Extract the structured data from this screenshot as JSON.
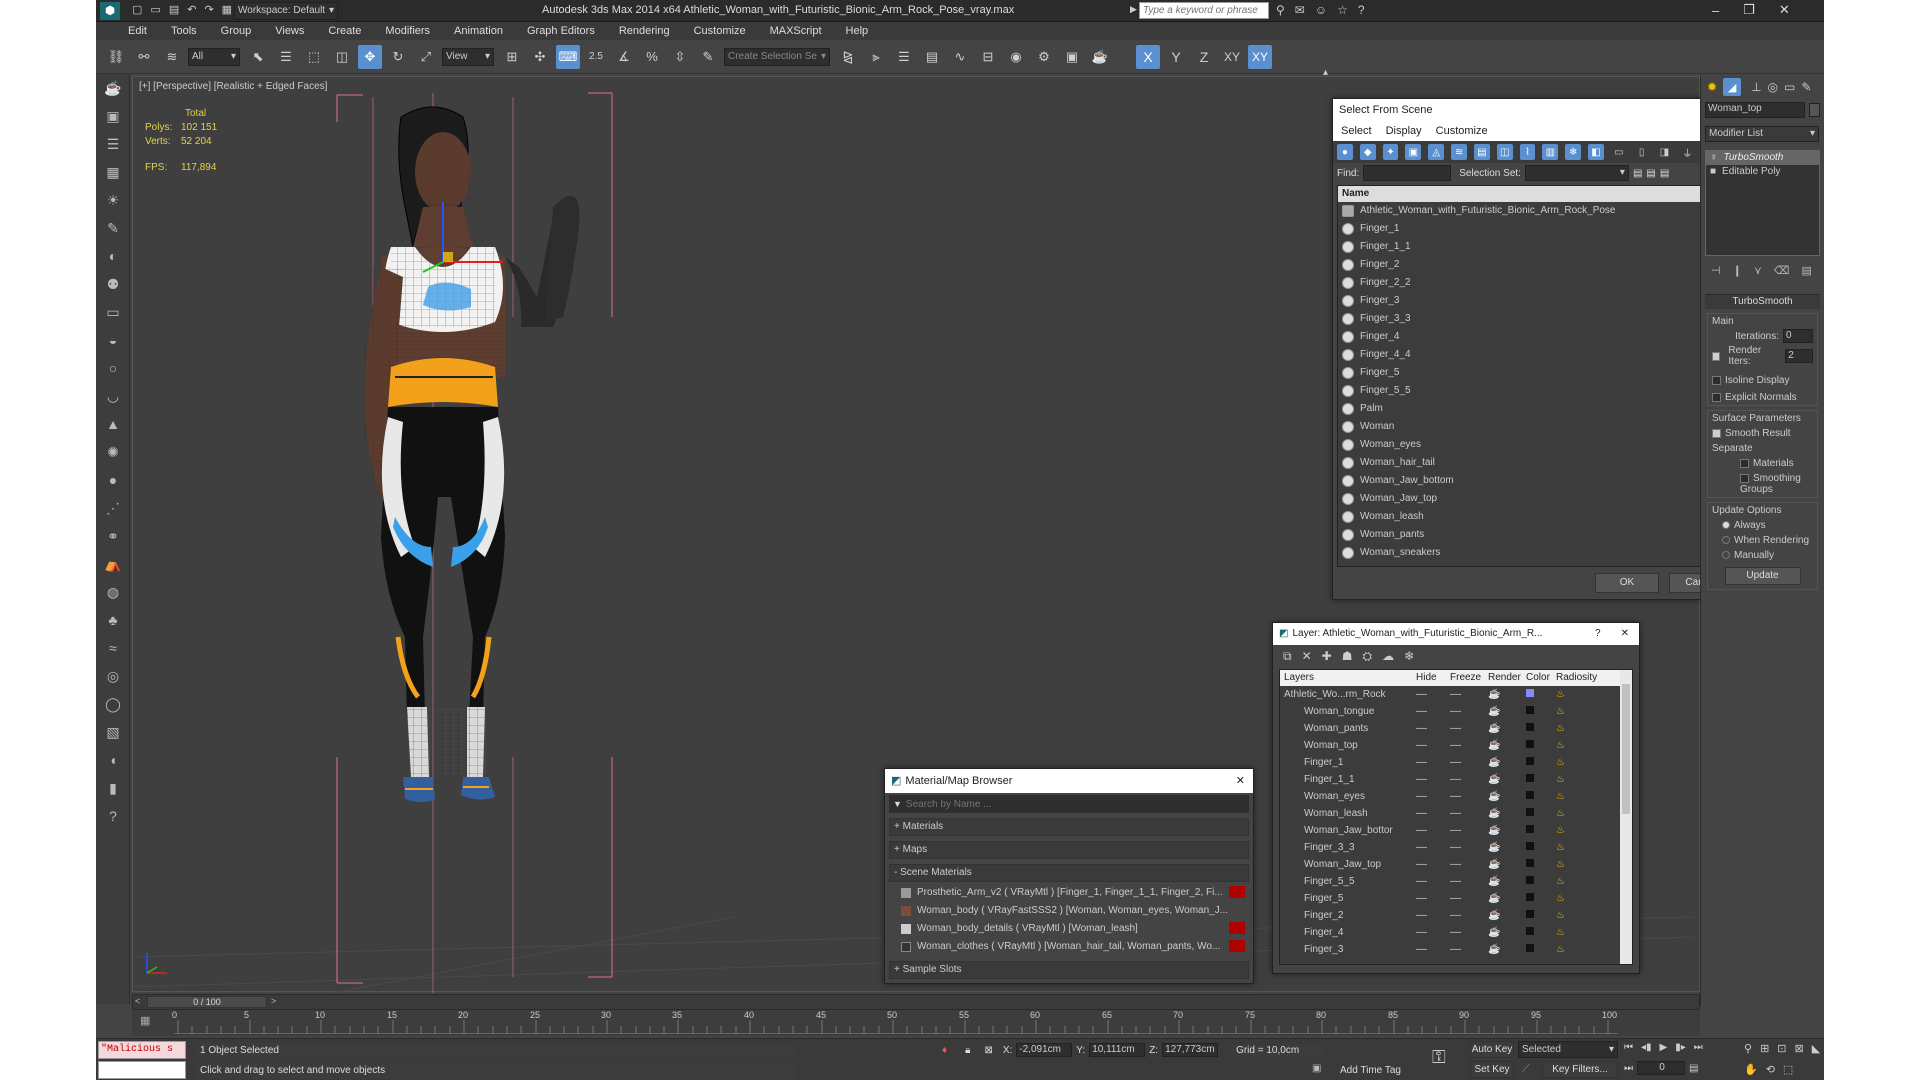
{
  "title_bar": {
    "workspace": "Workspace: Default",
    "title": "Autodesk 3ds Max  2014 x64    Athletic_Woman_with_Futuristic_Bionic_Arm_Rock_Pose_vray.max",
    "search_placeholder": "Type a keyword or phrase"
  },
  "menu": [
    "Edit",
    "Tools",
    "Group",
    "Views",
    "Create",
    "Modifiers",
    "Animation",
    "Graph Editors",
    "Rendering",
    "Customize",
    "MAXScript",
    "Help"
  ],
  "toolbar": {
    "filter": "All",
    "refcoord": "View",
    "selset_placeholder": "Create Selection Se",
    "angle_snap": "2.5",
    "axes": [
      "X",
      "Y",
      "Z",
      "XY",
      "XY"
    ]
  },
  "viewport": {
    "label": "[+] [Perspective] [Realistic + Edged Faces]",
    "stats": {
      "total_label": "Total",
      "polys_label": "Polys:",
      "polys": "102 151",
      "verts_label": "Verts:",
      "verts": "52 204",
      "fps_label": "FPS:",
      "fps": "117,894"
    }
  },
  "select_from_scene": {
    "title": "Select From Scene",
    "menu": [
      "Select",
      "Display",
      "Customize"
    ],
    "find_label": "Find:",
    "selection_set_label": "Selection Set:",
    "column_name": "Name",
    "items": [
      "Athletic_Woman_with_Futuristic_Bionic_Arm_Rock_Pose",
      "Finger_1",
      "Finger_1_1",
      "Finger_2",
      "Finger_2_2",
      "Finger_3",
      "Finger_3_3",
      "Finger_4",
      "Finger_4_4",
      "Finger_5",
      "Finger_5_5",
      "Palm",
      "Woman",
      "Woman_eyes",
      "Woman_hair_tail",
      "Woman_Jaw_bottom",
      "Woman_Jaw_top",
      "Woman_leash",
      "Woman_pants",
      "Woman_sneakers"
    ],
    "ok": "OK",
    "cancel": "Cancel"
  },
  "layer_dialog": {
    "title": "Layer: Athletic_Woman_with_Futuristic_Bionic_Arm_R...",
    "help": "?",
    "columns": [
      "Layers",
      "Hide",
      "Freeze",
      "Render",
      "Color",
      "Radiosity"
    ],
    "root": "Athletic_Wo...rm_Rock",
    "items": [
      "Woman_tongue",
      "Woman_pants",
      "Woman_top",
      "Finger_1",
      "Finger_1_1",
      "Woman_eyes",
      "Woman_leash",
      "Woman_Jaw_bottor",
      "Finger_3_3",
      "Woman_Jaw_top",
      "Finger_5_5",
      "Finger_5",
      "Finger_2",
      "Finger_4",
      "Finger_3"
    ]
  },
  "material_browser": {
    "title": "Material/Map Browser",
    "search_placeholder": "Search by Name ...",
    "sections": [
      "+ Materials",
      "+ Maps",
      "- Scene Materials"
    ],
    "materials": [
      "Prosthetic_Arm_v2  ( VRayMtl )  [Finger_1, Finger_1_1, Finger_2, Fi...",
      "Woman_body  ( VRayFastSSS2 )  [Woman, Woman_eyes, Woman_J...",
      "Woman_body_details  ( VRayMtl )  [Woman_leash]",
      "Woman_clothes  ( VRayMtl )  [Woman_hair_tail, Woman_pants, Wo..."
    ],
    "sample_slots": "+ Sample Slots"
  },
  "command_panel": {
    "object_name": "Woman_top",
    "modifier_list": "Modifier List",
    "stack": [
      "TurboSmooth",
      "Editable Poly"
    ],
    "rollout": "TurboSmooth",
    "main": "Main",
    "iterations_label": "Iterations:",
    "iterations": "0",
    "render_iters_label": "Render Iters:",
    "render_iters": "2",
    "isoline": "Isoline Display",
    "explicit_normals": "Explicit Normals",
    "surface_params": "Surface Parameters",
    "smooth_result": "Smooth Result",
    "separate": "Separate",
    "materials": "Materials",
    "smoothing_groups": "Smoothing Groups",
    "update_options": "Update Options",
    "always": "Always",
    "when_rendering": "When Rendering",
    "manually": "Manually",
    "update": "Update"
  },
  "timeline": {
    "frame": "0 / 100",
    "ticks": [
      "0",
      "5",
      "10",
      "15",
      "20",
      "25",
      "30",
      "35",
      "40",
      "45",
      "50",
      "55",
      "60",
      "65",
      "70",
      "75",
      "80",
      "85",
      "90",
      "95",
      "100"
    ]
  },
  "status": {
    "maxscript": "\"Malicious s",
    "selected": "1 Object Selected",
    "prompt": "Click and drag to select and move objects",
    "x_label": "X:",
    "x": "-2,091cm",
    "y_label": "Y:",
    "y": "10,111cm",
    "z_label": "Z:",
    "z": "127,773cm",
    "grid": "Grid = 10,0cm",
    "add_time_tag": "Add Time Tag",
    "auto_key": "Auto Key",
    "set_key": "Set Key",
    "selected_combo": "Selected",
    "key_filters": "Key Filters...",
    "frame_field": "0"
  }
}
